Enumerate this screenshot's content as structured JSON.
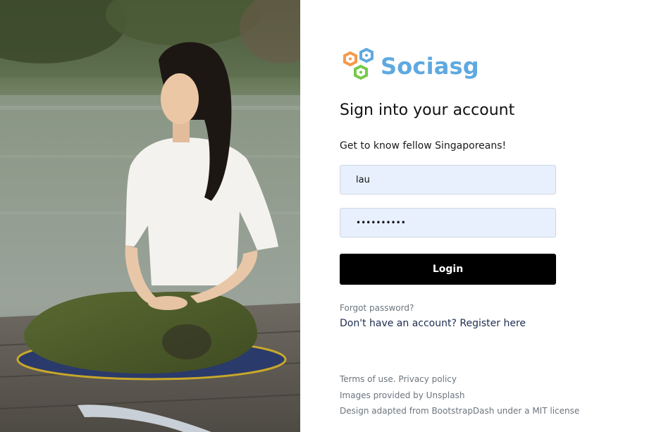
{
  "brand": {
    "name": "Sociasg",
    "logo_icon": "hexagon-gears-logo-icon",
    "colors": {
      "orange": "#f39a4a",
      "blue": "#5fa9e0",
      "green": "#76c94a"
    }
  },
  "hero": {
    "image_icon": "meditating-woman-photo"
  },
  "login": {
    "title": "Sign into your account",
    "subtitle": "Get to know fellow Singaporeans!",
    "username_value": "lau",
    "password_value": "••••••••••",
    "button_label": "Login",
    "forgot_label": "Forgot password?",
    "register_label": "Don't have an account? Register here",
    "input_bg": "#e8f0fe",
    "button_bg": "#000000"
  },
  "footer": {
    "terms_label": "Terms of use.",
    "privacy_label": "Privacy policy",
    "images_credit": "Images provided by Unsplash",
    "design_credit": "Design adapted from BootstrapDash under a MIT license"
  }
}
